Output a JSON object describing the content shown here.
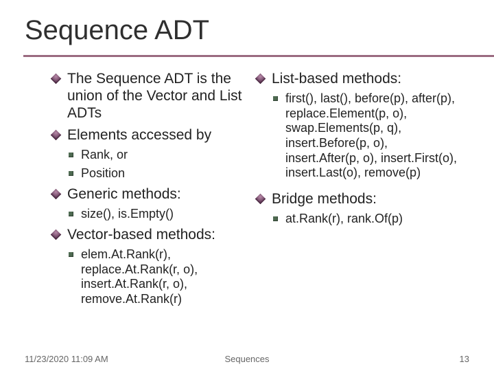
{
  "title": "Sequence ADT",
  "left": {
    "b1_intro": "The Sequence ADT is the union of the Vector and List ADTs",
    "b1_elements": "Elements accessed by",
    "elements_sub": {
      "a": "Rank, or",
      "b": "Position"
    },
    "b1_generic": "Generic methods:",
    "generic_sub": {
      "a": "size(), is.Empty()"
    },
    "b1_vector": "Vector-based methods:",
    "vector_sub": {
      "a": "elem.At.Rank(r), replace.At.Rank(r, o), insert.At.Rank(r, o), remove.At.Rank(r)"
    }
  },
  "right": {
    "b1_list": "List-based methods:",
    "list_sub": {
      "a": "first(), last(), before(p), after(p), replace.Element(p, o), swap.Elements(p, q), insert.Before(p, o), insert.After(p, o), insert.First(o), insert.Last(o), remove(p)"
    },
    "b1_bridge": "Bridge methods:",
    "bridge_sub": {
      "a": "at.Rank(r), rank.Of(p)"
    }
  },
  "footer": {
    "left": "11/23/2020 11:09 AM",
    "center": "Sequences",
    "right": "13"
  }
}
